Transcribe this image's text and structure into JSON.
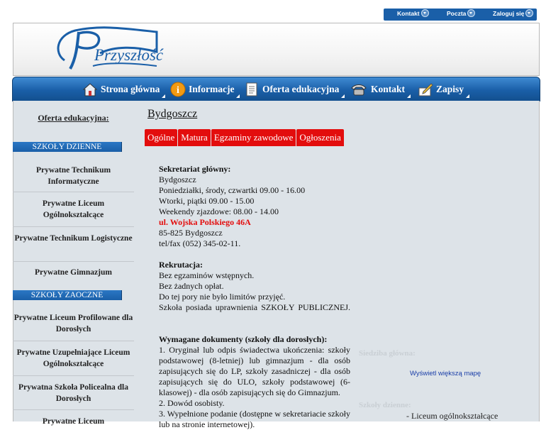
{
  "topbar": {
    "items": [
      {
        "label": "Kontakt"
      },
      {
        "label": "Poczta"
      },
      {
        "label": "Zaloguj się"
      }
    ]
  },
  "logo": {
    "text": "Przyszłość"
  },
  "nav": {
    "items": [
      {
        "label": "Strona główna",
        "icon": "home-icon"
      },
      {
        "label": "Informacje",
        "icon": "info-icon"
      },
      {
        "label": "Oferta edukacyjna",
        "icon": "document-icon"
      },
      {
        "label": "Kontakt",
        "icon": "phone-icon"
      },
      {
        "label": "Zapisy",
        "icon": "pen-icon"
      }
    ]
  },
  "sidebar": {
    "title": "Oferta edukacyjna:",
    "section1": "SZKOŁY DZIENNE",
    "items1": [
      "Prywatne Technikum Informatyczne",
      "Prywatne Liceum Ogólnokształcące",
      "Prywatne Technikum Logistyczne",
      "Prywatne Gimnazjum"
    ],
    "section2": "SZKOŁY ZAOCZNE",
    "items2": [
      "Prywatne Liceum Profilowane dla Dorosłych",
      "Prywatne Uzupełniające Liceum Ogólnokształcące",
      "Prywatna Szkoła Policealna dla Dorosłych",
      "Prywatne Liceum"
    ]
  },
  "main": {
    "title": "Bydgoszcz",
    "tabs": [
      "Ogólne",
      "Matura",
      "Egzaminy zawodowe",
      "Ogłoszenia"
    ],
    "secretariat": {
      "heading": "Sekretariat główny:",
      "lines": [
        "Bydgoszcz",
        "Poniedziałki, środy, czwartki 09.00 - 16.00",
        "Wtorki, piątki 09.00 - 15.00",
        "Weekendy zjazdowe: 08.00 - 14.00"
      ],
      "address": "ul. Wojska Polskiego 46A",
      "postal": "85-825 Bydgoszcz",
      "phone": "tel/fax (052) 345-02-11."
    },
    "recruitment": {
      "heading": "Rekrutacja:",
      "lines": [
        "Bez egzaminów wstępnych.",
        "Bez żadnych opłat.",
        "Do tej pory nie było limitów przyjęć."
      ],
      "rights": "Szkoła posiada uprawnienia SZKOŁY PUBLICZNEJ."
    },
    "documents": {
      "heading": "Wymagane dokumenty (szkoły dla dorosłych):",
      "item1": "1. Oryginał lub odpis świadectwa ukończenia: szkoły podstawowej (8-letniej) lub gimnazjum - dla osób zapisujących się do LP, szkoły zasadniczej - dla osób zapisujących się do ULO, szkoły podstawowej (6-klasowej) - dla osób zapisujących się do Gimnazjum.",
      "item2": "2. Dowód osobisty.",
      "item3": "3. Wypełnione podanie (dostępne w sekretariacie szkoły lub na stronie internetowej)."
    }
  },
  "right": {
    "seat_label": "Siedziba główna:",
    "map_link": "Wyświetl większą mapę",
    "schools_label": "Szkoły dzienne:",
    "school_item": "- Liceum ogólnokształcące"
  },
  "colors": {
    "accent": "#1a5fa8",
    "tab_red": "#e30d0d",
    "content_bg": "#dde3e8"
  }
}
